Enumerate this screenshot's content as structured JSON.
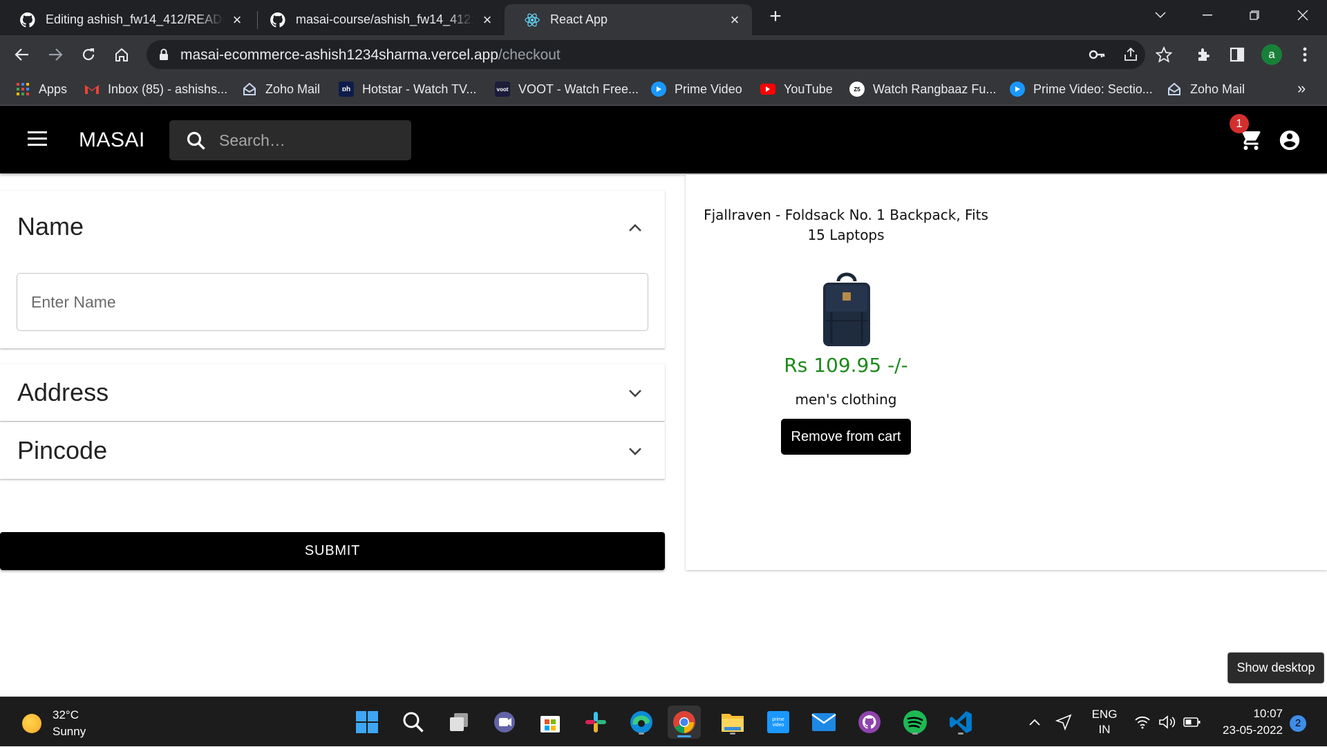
{
  "browser": {
    "tabs": [
      {
        "title": "Editing ashish_fw14_412/README.md",
        "icon": "github-icon",
        "active": false
      },
      {
        "title": "masai-course/ashish_fw14_412: i",
        "icon": "github-icon",
        "active": false
      },
      {
        "title": "React App",
        "icon": "react-icon",
        "active": true
      }
    ],
    "url_host": "masai-ecommerce-ashish1234sharma.vercel.app",
    "url_path": "/checkout",
    "profile_initial": "a",
    "bookmarks": [
      {
        "label": "Apps",
        "icon": "apps-grid-icon"
      },
      {
        "label": "Inbox (85) - ashishs...",
        "icon": "gmail-icon"
      },
      {
        "label": "Zoho Mail",
        "icon": "zoho-mail-icon"
      },
      {
        "label": "Hotstar - Watch TV...",
        "icon": "hotstar-icon"
      },
      {
        "label": "VOOT - Watch Free...",
        "icon": "voot-icon"
      },
      {
        "label": "Prime Video",
        "icon": "prime-video-icon"
      },
      {
        "label": "YouTube",
        "icon": "youtube-icon"
      },
      {
        "label": "Watch Rangbaaz Fu...",
        "icon": "zee5-icon"
      },
      {
        "label": "Prime Video: Sectio...",
        "icon": "prime-video-icon"
      },
      {
        "label": "Zoho Mail",
        "icon": "zoho-mail-icon"
      }
    ],
    "bookmarks_more": "»"
  },
  "app": {
    "brand": "MASAI",
    "search_placeholder": "Search…",
    "cart_count": "1"
  },
  "form": {
    "name_title": "Name",
    "name_placeholder": "Enter Name",
    "address_title": "Address",
    "pincode_title": "Pincode",
    "submit_label": "SUBMIT"
  },
  "cart": {
    "product_title": "Fjallraven - Foldsack No. 1 Backpack, Fits 15 Laptops",
    "price": "Rs 109.95 -/-",
    "category": "men's clothing",
    "remove_label": "Remove from cart"
  },
  "taskbar": {
    "temperature": "32°C",
    "weather": "Sunny",
    "language": "ENG",
    "region": "IN",
    "time": "10:07",
    "date": "23-05-2022",
    "notifications": "2",
    "show_desktop": "Show desktop"
  },
  "colors": {
    "price_green": "#1b8a1b",
    "appbar": "#000000",
    "badge_red": "#d32f2f"
  }
}
